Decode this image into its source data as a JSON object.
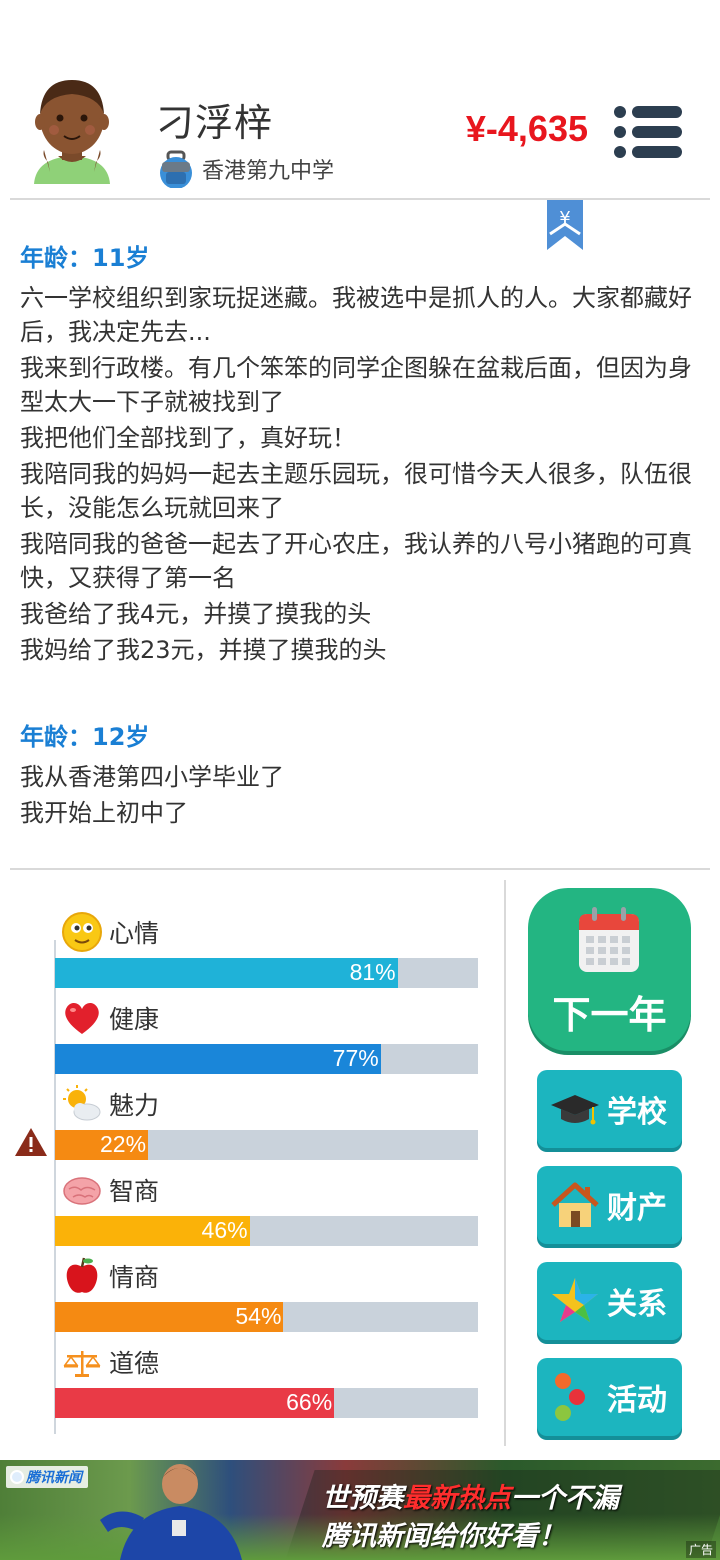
{
  "header": {
    "name": "刁浮梓",
    "school": "香港第九中学",
    "money": "¥-4,635"
  },
  "bookmark_symbol": "¥",
  "log": [
    {
      "age": "年龄：11岁",
      "lines": [
        "六一学校组织到家玩捉迷藏。我被选中是抓人的人。大家都藏好后，我决定先去...",
        "我来到行政楼。有几个笨笨的同学企图躲在盆栽后面，但因为身型太大一下子就被找到了",
        "我把他们全部找到了，真好玩！",
        "我陪同我的妈妈一起去主题乐园玩，很可惜今天人很多，队伍很长，没能怎么玩就回来了",
        "我陪同我的爸爸一起去了开心农庄，我认养的八号小猪跑的可真快，又获得了第一名",
        "我爸给了我4元，并摸了摸我的头",
        "我妈给了我23元，并摸了摸我的头"
      ]
    },
    {
      "age": "年龄：12岁",
      "lines": [
        "我从香港第四小学毕业了",
        "我开始上初中了"
      ]
    }
  ],
  "stats": [
    {
      "label": "心情",
      "icon": "smiley-icon",
      "value": 81,
      "pct": "81%",
      "color": "#1fb2d8"
    },
    {
      "label": "健康",
      "icon": "heart-icon",
      "value": 77,
      "pct": "77%",
      "color": "#1a86d9"
    },
    {
      "label": "魅力",
      "icon": "sun-cloud-icon",
      "value": 22,
      "pct": "22%",
      "color": "#f58a12"
    },
    {
      "label": "智商",
      "icon": "brain-icon",
      "value": 46,
      "pct": "46%",
      "color": "#fbb208"
    },
    {
      "label": "情商",
      "icon": "apple-icon",
      "value": 54,
      "pct": "54%",
      "color": "#f58a12"
    },
    {
      "label": "道德",
      "icon": "scales-icon",
      "value": 66,
      "pct": "66%",
      "color": "#e93a46"
    }
  ],
  "buttons": {
    "next_year": "下一年",
    "school": "学校",
    "property": "财产",
    "relations": "关系",
    "activities": "活动"
  },
  "ad": {
    "brand": "腾讯新闻",
    "line1_a": "世预赛",
    "line1_hot": "最新热点",
    "line1_b": "一个不漏",
    "line2": "腾讯新闻给你好看！",
    "tag": "广告"
  },
  "colors": {
    "money": "#e8161e",
    "age_heading": "#1a7fd4",
    "next_year_button": "#23b582",
    "side_button": "#1cb5bf",
    "bar_track": "#c9d2db"
  }
}
